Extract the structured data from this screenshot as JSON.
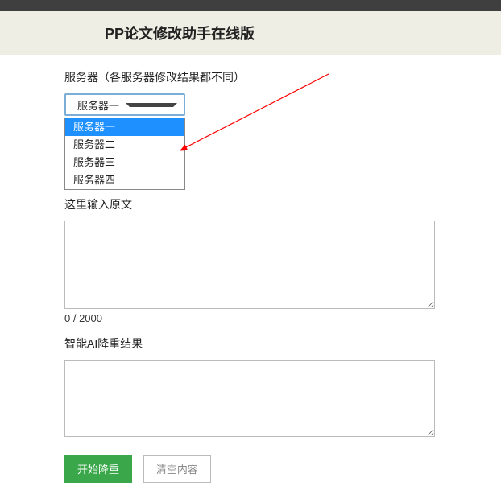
{
  "header": {
    "title_prefix": "PP",
    "title_rest": "论文修改助手在线版"
  },
  "server": {
    "label": "服务器（各服务器修改结果都不同）",
    "selected": "服务器一",
    "options": [
      "服务器一",
      "服务器二",
      "服务器三",
      "服务器四"
    ],
    "selected_index": 0
  },
  "input_section": {
    "label": "这里输入原文",
    "value": "",
    "counter": "0 / 2000"
  },
  "result_section": {
    "label": "智能AI降重结果",
    "value": ""
  },
  "buttons": {
    "start": "开始降重",
    "clear": "清空内容"
  },
  "annotation": {
    "arrow_color": "#ff0000"
  }
}
